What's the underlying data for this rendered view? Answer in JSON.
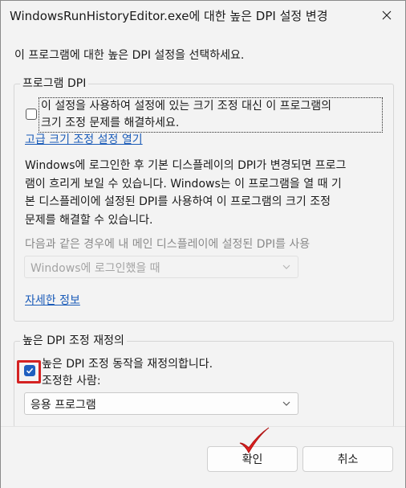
{
  "window": {
    "title": "WindowsRunHistoryEditor.exe에 대한 높은 DPI 설정 변경"
  },
  "intro": "이 프로그램에 대한 높은 DPI 설정을 선택하세요.",
  "program_dpi": {
    "legend": "프로그램 DPI",
    "checkbox_checked": false,
    "checkbox_label_line1": "이 설정을 사용하여 설정에 있는 크기 조정 대신 이 프로그램의",
    "checkbox_label_line2": "크기 조정 문제를 해결하세요.",
    "advanced_link": "고급 크기 조정 설정 열기",
    "description_line1": "Windows에 로그인한 후 기본 디스플레이의 DPI가 변경되면 프로그",
    "description_line2": "램이 흐리게 보일 수 있습니다. Windows는 이 프로그램을 열 때 기",
    "description_line3": "본 디스플레이에 설정된 DPI를 사용하여 이 프로그램의 크기 조정",
    "description_line4": "문제를 해결할 수 있습니다.",
    "use_dpi_label": "다음과 같은 경우에 내 메인 디스플레이에 설정된 DPI를 사용",
    "use_dpi_select_value": "Windows에 로그인했을 때",
    "more_info_link": "자세한 정보"
  },
  "override": {
    "legend": "높은 DPI 조정 재정의",
    "checkbox_checked": true,
    "checkbox_label": "높은 DPI 조정 동작을 재정의합니다.",
    "scaled_by_label": "조정한 사람:",
    "scaled_by_value": "응용 프로그램"
  },
  "buttons": {
    "ok": "확인",
    "cancel": "취소"
  },
  "colors": {
    "accent": "#1f5fbf",
    "link": "#1a5bb8",
    "highlight": "#d42222"
  }
}
